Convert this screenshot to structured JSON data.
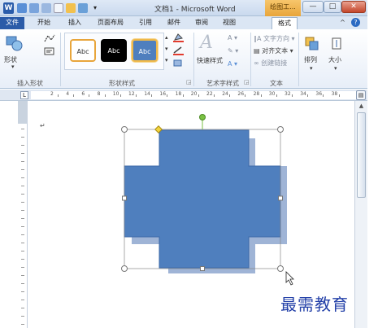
{
  "titlebar": {
    "app_icon_letter": "W",
    "title": "文档1 - Microsoft Word",
    "context_tab": "绘图工...",
    "min": "—",
    "max": "□",
    "close": "✕"
  },
  "tabs": [
    {
      "label": "文件"
    },
    {
      "label": "开始"
    },
    {
      "label": "插入"
    },
    {
      "label": "页面布局"
    },
    {
      "label": "引用"
    },
    {
      "label": "邮件"
    },
    {
      "label": "审阅"
    },
    {
      "label": "视图"
    },
    {
      "label": "格式"
    }
  ],
  "ribbon": {
    "insert_shape": {
      "shape_label": "形状",
      "group": "插入形状"
    },
    "shape_styles": {
      "styles": [
        "Abc",
        "Abc",
        "Abc"
      ],
      "group": "形状样式"
    },
    "art_text": {
      "quick_styles": "快速样式",
      "group": "艺术字样式",
      "letter": "A"
    },
    "text": {
      "direction": "文字方向",
      "align": "对齐文本",
      "link": "创建链接",
      "group": "文本"
    },
    "arrange": {
      "label": "排列"
    },
    "size": {
      "label": "大小"
    }
  },
  "ruler": {
    "numbers": [
      "2",
      "4",
      "6",
      "8",
      "10",
      "12",
      "14",
      "16",
      "18",
      "20",
      "22",
      "24",
      "26",
      "28",
      "30",
      "32",
      "34",
      "36",
      "38"
    ]
  },
  "document": {
    "paragraph_mark": "↵"
  },
  "watermark": "最需教育",
  "colors": {
    "shape_fill": "#4f7fbe",
    "shape_stroke": "#3c6aa8",
    "shadow": "#7f9bc8",
    "selection_handle": "#ffffff",
    "rotate_handle": "#7ac143",
    "adjust_handle": "#f2d43d"
  }
}
